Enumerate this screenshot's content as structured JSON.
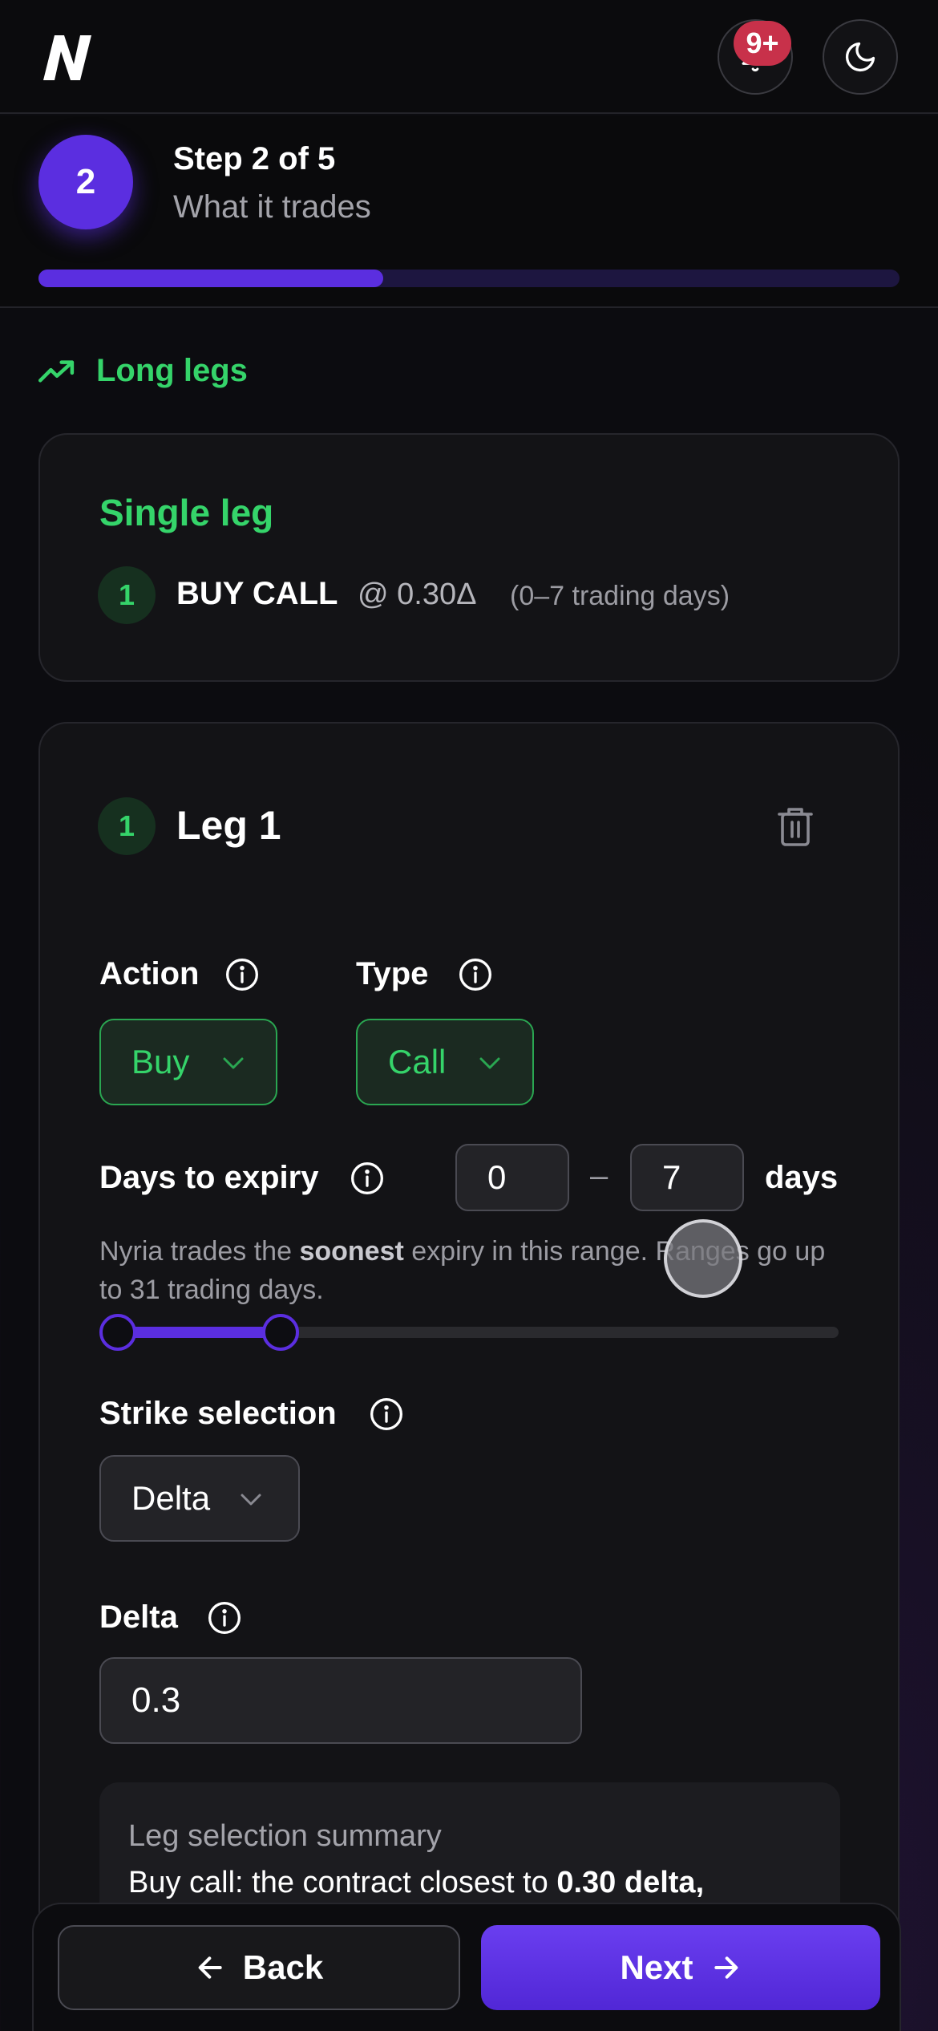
{
  "header": {
    "notification_badge": "9+",
    "icons": {
      "logo": "nyria-logo",
      "notifications": "bell-icon",
      "theme": "moon-icon"
    }
  },
  "stepper": {
    "step_number": "2",
    "title": "Step 2 of 5",
    "subtitle": "What it trades",
    "progress": 0.4
  },
  "section": {
    "label": "Long legs",
    "icon": "trending-up-icon"
  },
  "summary_card": {
    "title": "Single leg",
    "leg_number": "1",
    "leg_action": "BUY CALL",
    "leg_delta": "@ 0.30Δ",
    "leg_days": "(0–7 trading days)"
  },
  "leg": {
    "number": "1",
    "title": "Leg 1",
    "action": {
      "label": "Action",
      "value": "Buy"
    },
    "type": {
      "label": "Type",
      "value": "Call"
    },
    "days_to_expiry": {
      "label": "Days to expiry",
      "min": "0",
      "separator": "–",
      "max": "7",
      "unit": "days",
      "hint_pre": "Nyria trades the ",
      "hint_bold": "soonest",
      "hint_post": " expiry in this range. Ranges go up to 31 trading days.",
      "range_min": 0,
      "range_max": 7,
      "scale_max": 31
    },
    "strike_selection": {
      "label": "Strike selection",
      "value": "Delta"
    },
    "delta": {
      "label": "Delta",
      "value": "0.3"
    },
    "summary": {
      "title": "Leg selection summary",
      "body_pre": "Buy call: the contract closest to ",
      "body_bold": "0.30 delta,"
    }
  },
  "footer": {
    "back_label": "Back",
    "next_label": "Next"
  },
  "colors": {
    "accent": "#5b2ee0",
    "green": "#35d46a",
    "badge": "#c8314a"
  }
}
